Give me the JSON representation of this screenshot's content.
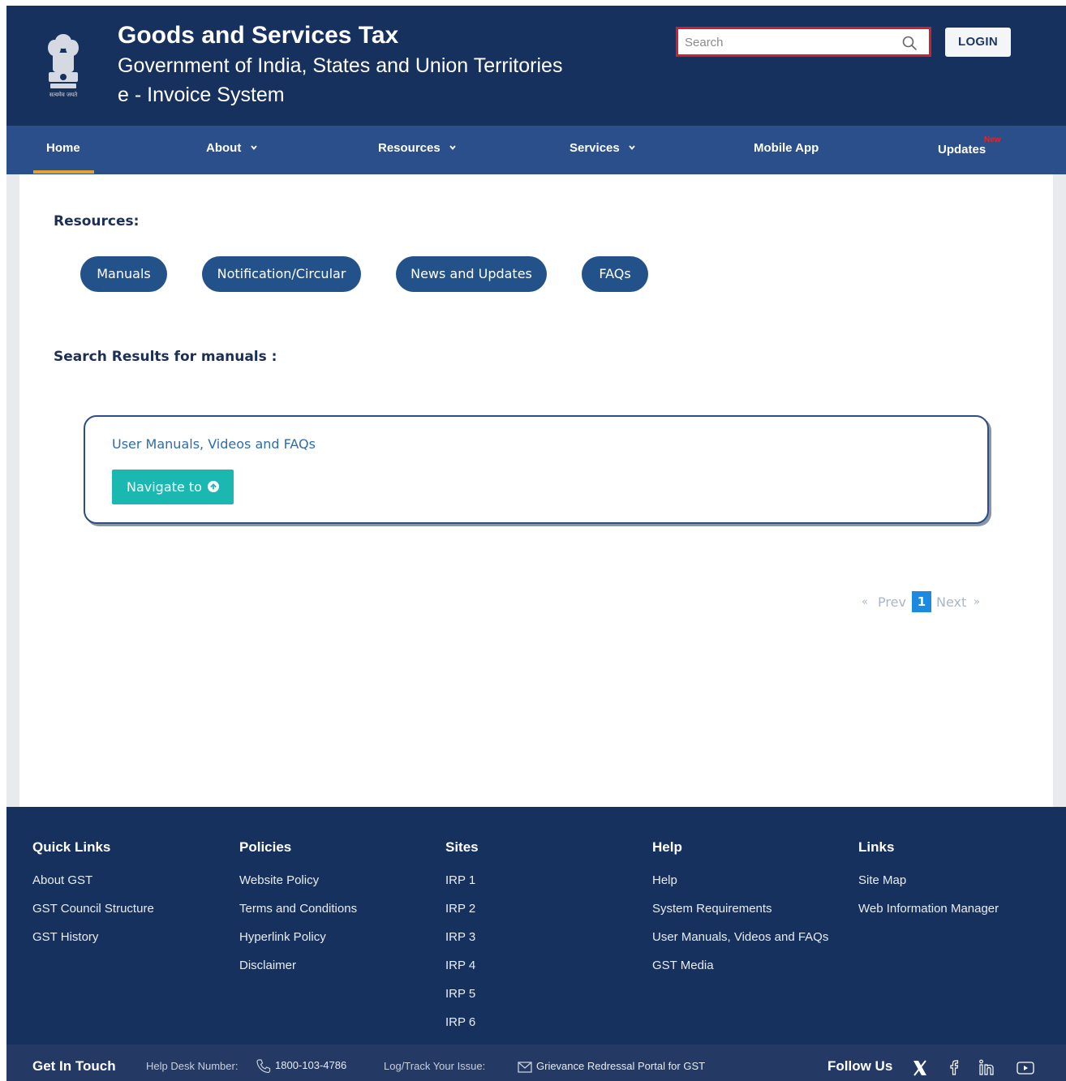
{
  "header": {
    "title": "Goods and Services Tax",
    "subtitle": "Government of India, States and Union Territories",
    "system": "e - Invoice System",
    "search_placeholder": "Search",
    "login_label": "LOGIN",
    "emblem_caption": "सत्यमेव जयते"
  },
  "nav": {
    "items": [
      {
        "label": "Home",
        "active": true
      },
      {
        "label": "About",
        "dropdown": true
      },
      {
        "label": "Resources",
        "dropdown": true
      },
      {
        "label": "Services",
        "dropdown": true
      },
      {
        "label": "Mobile App"
      },
      {
        "label": "Updates",
        "badge": "New"
      }
    ]
  },
  "content": {
    "resources_label": "Resources:",
    "resource_buttons": [
      "Manuals",
      "Notification/Circular",
      "News and Updates",
      "FAQs"
    ],
    "results_label": "Search Results for manuals :",
    "result": {
      "title": "User Manuals, Videos and FAQs",
      "button_label": "Navigate to"
    },
    "pagination": {
      "prev_symbol": "«",
      "prev_label": "Prev",
      "current_page": "1",
      "next_label": "Next",
      "next_symbol": "»"
    }
  },
  "footer": {
    "columns": [
      {
        "heading": "Quick Links",
        "links": [
          "About GST",
          "GST Council Structure",
          "GST History"
        ]
      },
      {
        "heading": "Policies",
        "links": [
          "Website Policy",
          "Terms and Conditions",
          "Hyperlink Policy",
          "Disclaimer"
        ]
      },
      {
        "heading": "Sites",
        "links": [
          "IRP 1",
          "IRP 2",
          "IRP 3",
          "IRP 4",
          "IRP 5",
          "IRP 6"
        ]
      },
      {
        "heading": "Help",
        "links": [
          "Help",
          "System Requirements",
          "User Manuals, Videos and FAQs",
          "GST Media"
        ]
      },
      {
        "heading": "Links",
        "links": [
          "Site Map",
          "Web Information Manager"
        ]
      }
    ],
    "bottom": {
      "get_in_touch": "Get In Touch",
      "helpdesk_label": "Help Desk Number:",
      "helpdesk_number": "1800-103-4786",
      "track_label": "Log/Track Your Issue:",
      "grievance_link": "Grievance Redressal Portal for GST",
      "follow_us": "Follow Us"
    }
  },
  "colors": {
    "header_bg": "#17315f",
    "nav_bg": "#2b4f8a",
    "pill_bg": "#23528a",
    "navigate_bg": "#1bb8b1",
    "active_underline": "#e2a32a",
    "search_border": "#d21f2d"
  }
}
